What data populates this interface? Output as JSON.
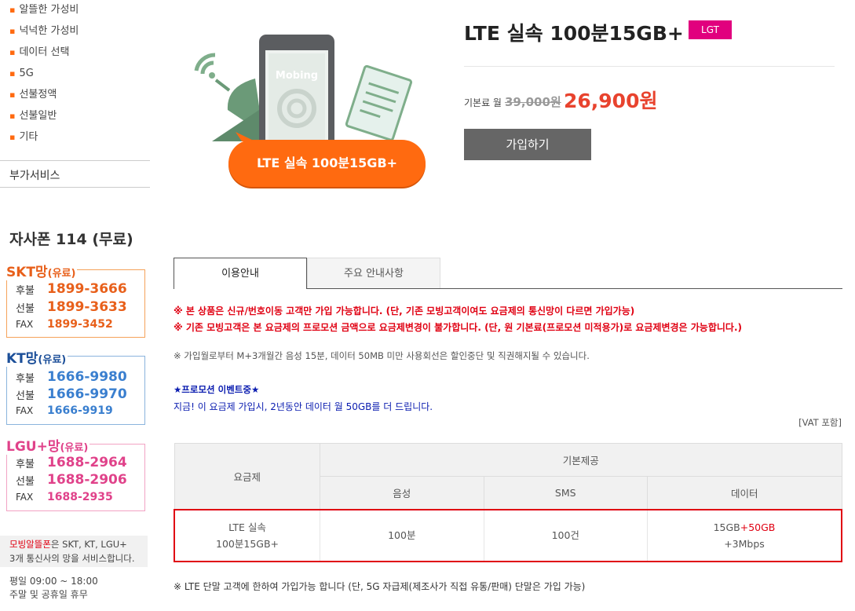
{
  "sidebar": {
    "categories": [
      "알뜰한 가성비",
      "넉넉한 가성비",
      "데이터 선택",
      "5G",
      "선불정액",
      "선불일반",
      "기타"
    ],
    "addon_service": "부가서비스",
    "phone114": "자사폰 114 (무료)",
    "carriers": {
      "skt": {
        "name": "SKT망",
        "paid": "(유료)",
        "postpaid_label": "후불",
        "postpaid": "1899-3666",
        "prepaid_label": "선불",
        "prepaid": "1899-3633",
        "fax_label": "FAX",
        "fax": "1899-3452"
      },
      "kt": {
        "name": "KT망",
        "paid": "(유료)",
        "postpaid_label": "후불",
        "postpaid": "1666-9980",
        "prepaid_label": "선불",
        "prepaid": "1666-9970",
        "fax_label": "FAX",
        "fax": "1666-9919"
      },
      "lgu": {
        "name": "LGU+망",
        "paid": "(유료)",
        "postpaid_label": "후불",
        "postpaid": "1688-2964",
        "prepaid_label": "선불",
        "prepaid": "1688-2906",
        "fax_label": "FAX",
        "fax": "1688-2935"
      }
    },
    "notice_brand": "모빙알뜰폰",
    "notice_rest1": "은 SKT, KT, LGU+",
    "notice_rest2": "3개 통신사의 망을 서비스합니다.",
    "hours_weekday": "평일  09:00 ~ 18:00",
    "hours_weekend": "주말 및 공휴일  휴무"
  },
  "visual": {
    "phone_brand": "Mobing",
    "pill_label": "LTE 실속 100분15GB+",
    "colors": {
      "orange": "#ff6a10",
      "green": "#6b9a78",
      "phone": "#5b5d60"
    }
  },
  "product": {
    "title": "LTE 실속 100분15GB+",
    "badge": "LGT",
    "price_label": "기본료 월",
    "price_old": "39,000원",
    "price_new": "26,900원",
    "join_button": "가입하기"
  },
  "tabs": [
    {
      "label": "이용안내",
      "active": true
    },
    {
      "label": "주요 안내사항",
      "active": false
    }
  ],
  "notes": {
    "red1": "※ 본 상품은 신규/번호이동 고객만 가입 가능합니다. (단, 기존 모빙고객이여도 요금제의 통신망이 다르면 가입가능)",
    "red2": "※ 기존 모빙고객은 본 요금제의 프로모션 금액으로 요금제변경이 불가합니다. (단, 원 기본료(프로모션 미적용가)로 요금제변경은 가능합니다.)",
    "gray": "※ 가입월로부터 M+3개월간 음성 15분, 데이터 50MB 미만 사용회선은 할인중단 및 직권해지될 수 있습니다.",
    "promo_title": "★프로모션 이벤트중★",
    "promo_text": "지금! 이 요금제 가입시, 2년동안 데이터 월 50GB를 더 드립니다.",
    "vat": "[VAT 포함]",
    "footer": "※ LTE 단말 고객에 한하여 가입가능 합니다 (단, 5G 자급제(제조사가 직접 유통/판매) 단말은 가입 가능)"
  },
  "table": {
    "col_plan": "요금제",
    "col_basic": "기본제공",
    "col_voice": "음성",
    "col_sms": "SMS",
    "col_data": "데이터",
    "row": {
      "plan_line1": "LTE 실속",
      "plan_line2": "100분15GB+",
      "voice": "100분",
      "sms": "100건",
      "data_base": "15GB",
      "data_bonus": "+50GB",
      "data_speed": "+3Mbps"
    }
  }
}
